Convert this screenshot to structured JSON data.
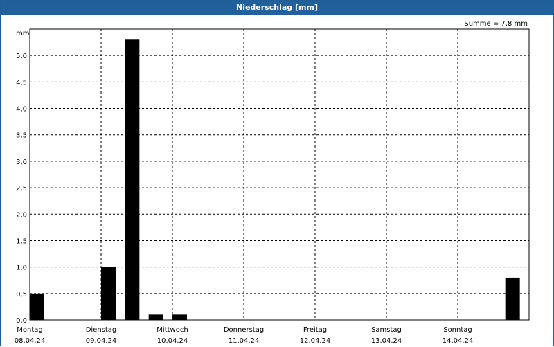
{
  "window": {
    "title": "Niederschlag [mm]"
  },
  "chart_data": {
    "type": "bar",
    "title": "Niederschlag [mm]",
    "ylabel": "mm",
    "summary": "Summe = 7,8 mm",
    "ylim": [
      0,
      5.5
    ],
    "yticks": [
      "0,0",
      "0,5",
      "1,0",
      "1,5",
      "2,0",
      "2,5",
      "3,0",
      "3,5",
      "4,0",
      "4,5",
      "5,0"
    ],
    "days": [
      {
        "weekday": "Montag",
        "date": "08.04.24"
      },
      {
        "weekday": "Dienstag",
        "date": "09.04.24"
      },
      {
        "weekday": "Mittwoch",
        "date": "10.04.24"
      },
      {
        "weekday": "Donnerstag",
        "date": "11.04.24"
      },
      {
        "weekday": "Freitag",
        "date": "12.04.24"
      },
      {
        "weekday": "Samstag",
        "date": "13.04.24"
      },
      {
        "weekday": "Sonntag",
        "date": "14.04.24"
      }
    ],
    "bars": [
      {
        "day": "08.04.24",
        "time": "00:00",
        "value": 0.5
      },
      {
        "day": "09.04.24",
        "time": "00:00",
        "value": 1.0
      },
      {
        "day": "09.04.24",
        "time": "08:00",
        "value": 5.3
      },
      {
        "day": "09.04.24",
        "time": "16:00",
        "value": 0.1
      },
      {
        "day": "10.04.24",
        "time": "00:00",
        "value": 0.1
      },
      {
        "day": "14.04.24",
        "time": "16:00",
        "value": 0.8
      }
    ],
    "grid": true,
    "colors": {
      "bar": "#000000",
      "titlebar": "#21609b",
      "grid": "#000000"
    }
  }
}
